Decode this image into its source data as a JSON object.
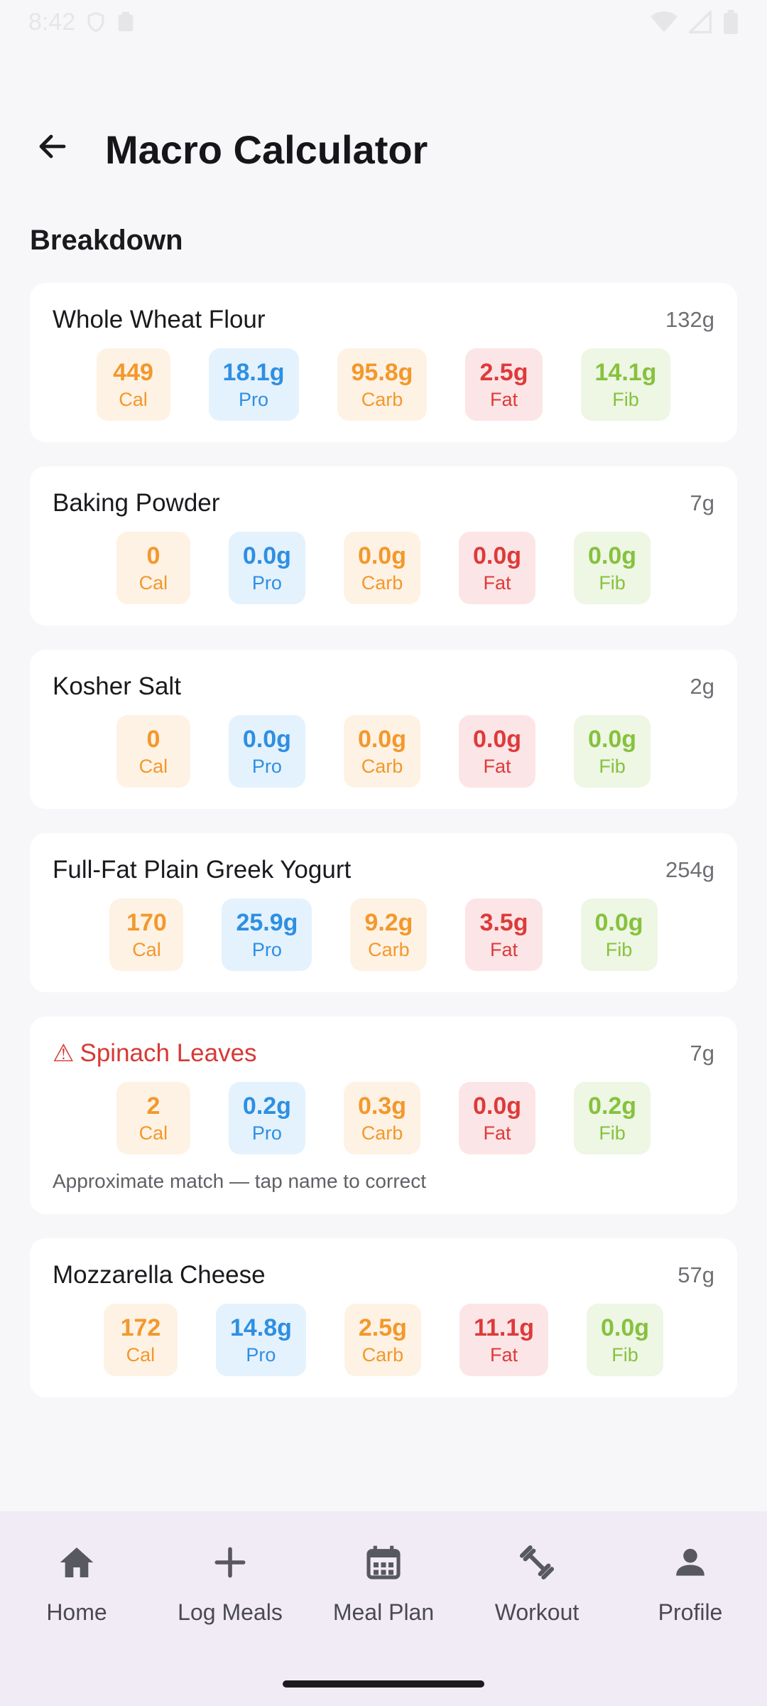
{
  "status_bar": {
    "time": "8:42"
  },
  "header": {
    "title": "Macro Calculator"
  },
  "section": {
    "title": "Breakdown"
  },
  "colors": {
    "cal": "#f3982c",
    "pro": "#2e8fe2",
    "carb": "#f3982c",
    "fat": "#de3a3a",
    "fib": "#86c23d",
    "warning": "#d63a35"
  },
  "macro_labels": {
    "cal": "Cal",
    "pro": "Pro",
    "carb": "Carb",
    "fat": "Fat",
    "fib": "Fib"
  },
  "foods": [
    {
      "name": "Whole Wheat Flour",
      "weight": "132g",
      "cal": "449",
      "pro": "18.1g",
      "carb": "95.8g",
      "fat": "2.5g",
      "fib": "14.1g"
    },
    {
      "name": "Baking Powder",
      "weight": "7g",
      "cal": "0",
      "pro": "0.0g",
      "carb": "0.0g",
      "fat": "0.0g",
      "fib": "0.0g"
    },
    {
      "name": "Kosher Salt",
      "weight": "2g",
      "cal": "0",
      "pro": "0.0g",
      "carb": "0.0g",
      "fat": "0.0g",
      "fib": "0.0g"
    },
    {
      "name": "Full-Fat Plain Greek Yogurt",
      "weight": "254g",
      "cal": "170",
      "pro": "25.9g",
      "carb": "9.2g",
      "fat": "3.5g",
      "fib": "0.0g"
    },
    {
      "name": "Spinach Leaves",
      "weight": "7g",
      "cal": "2",
      "pro": "0.2g",
      "carb": "0.3g",
      "fat": "0.0g",
      "fib": "0.2g",
      "warning_icon": "⚠",
      "note": "Approximate match — tap name to correct"
    },
    {
      "name": "Mozzarella Cheese",
      "weight": "57g",
      "cal": "172",
      "pro": "14.8g",
      "carb": "2.5g",
      "fat": "11.1g",
      "fib": "0.0g"
    }
  ],
  "nav": [
    {
      "label": "Home",
      "icon": "home-icon"
    },
    {
      "label": "Log Meals",
      "icon": "plus-icon"
    },
    {
      "label": "Meal Plan",
      "icon": "calendar-icon"
    },
    {
      "label": "Workout",
      "icon": "dumbbell-icon"
    },
    {
      "label": "Profile",
      "icon": "person-icon"
    }
  ]
}
